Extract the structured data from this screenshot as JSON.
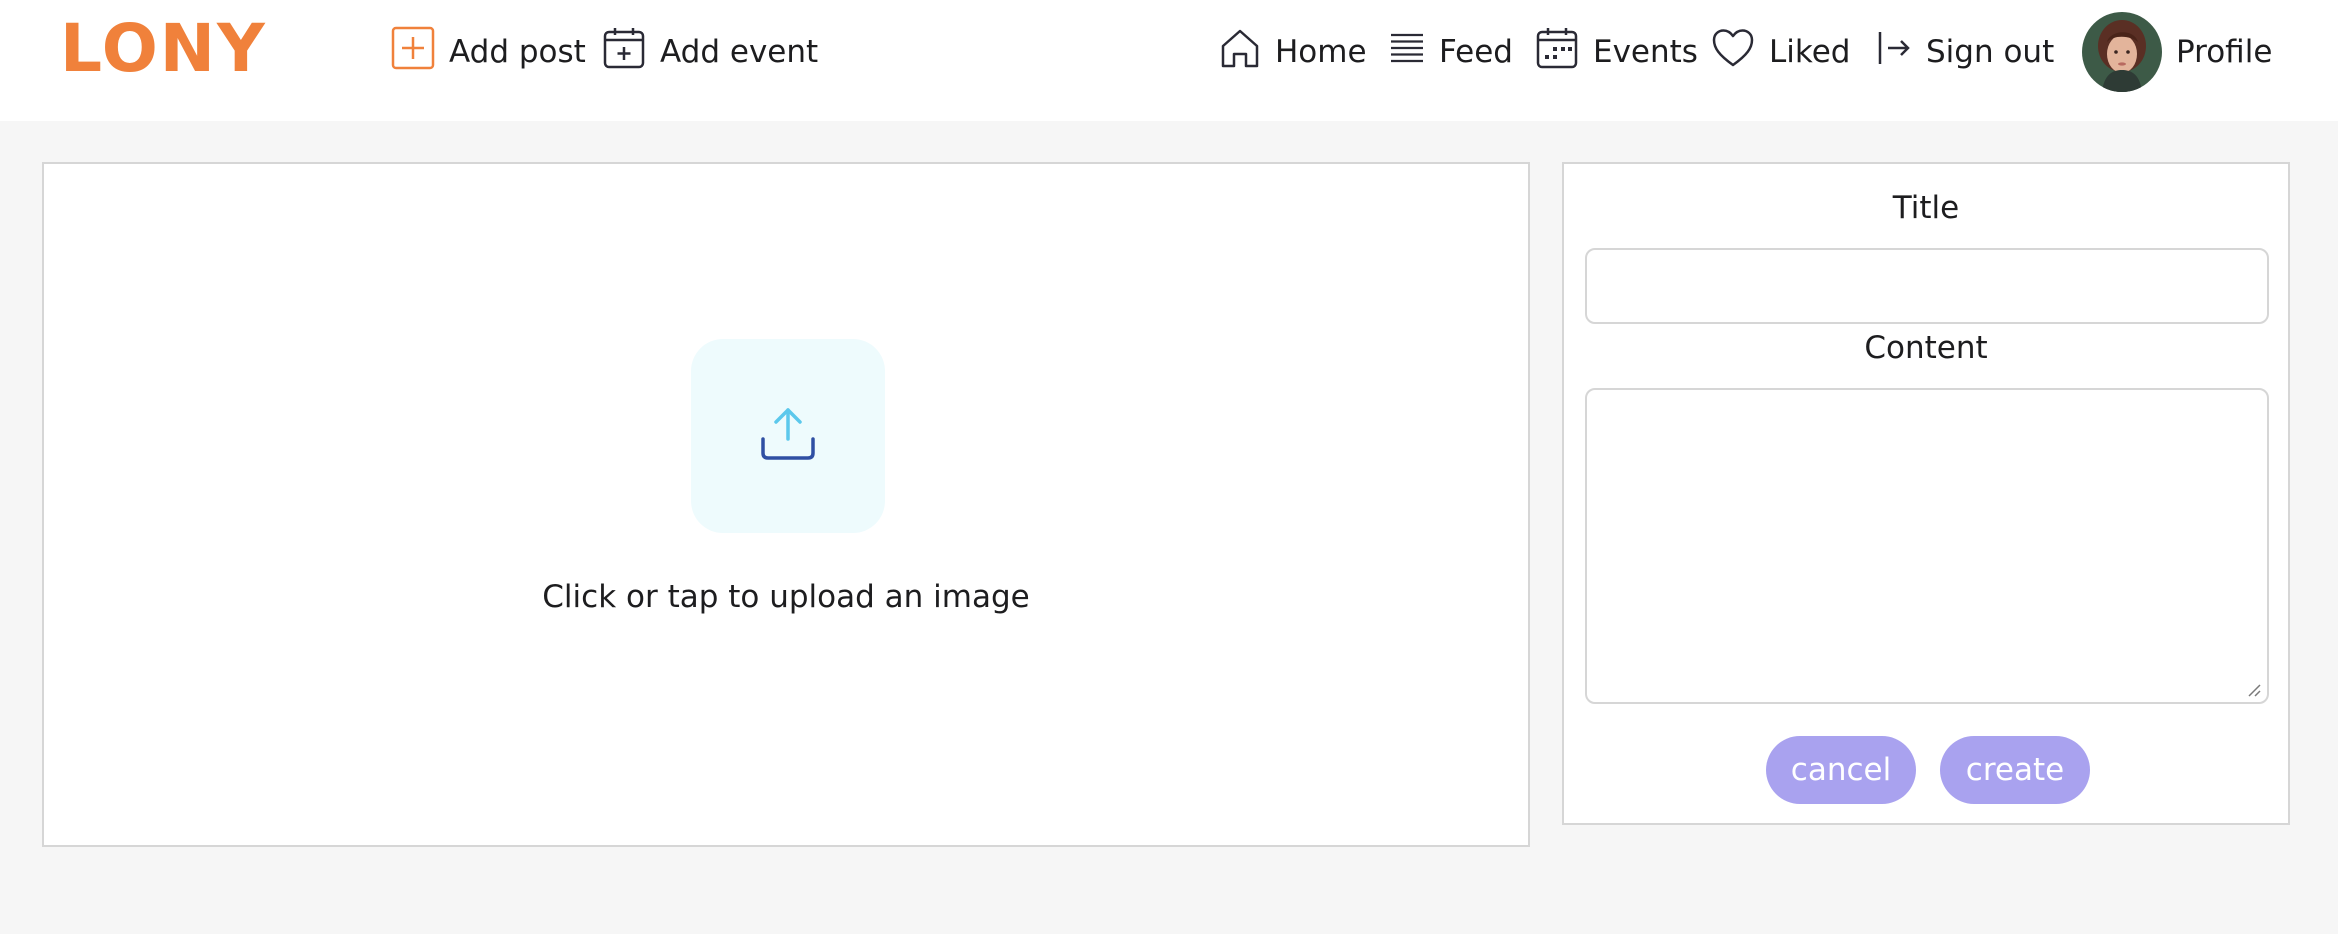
{
  "brand": {
    "logo_text": "LONY",
    "accent": "#f0813b"
  },
  "nav": {
    "add_post": {
      "label": "Add post",
      "icon": "plus-square-icon"
    },
    "add_event": {
      "label": "Add event",
      "icon": "calendar-plus-icon"
    },
    "home": {
      "label": "Home",
      "icon": "home-icon"
    },
    "feed": {
      "label": "Feed",
      "icon": "list-icon"
    },
    "events": {
      "label": "Events",
      "icon": "calendar-icon"
    },
    "liked": {
      "label": "Liked",
      "icon": "heart-icon"
    },
    "sign_out": {
      "label": "Sign out",
      "icon": "sign-out-icon"
    },
    "profile": {
      "label": "Profile",
      "icon": "avatar"
    }
  },
  "upload": {
    "prompt": "Click or tap to upload an image",
    "icon": "upload-icon"
  },
  "form": {
    "title_label": "Title",
    "title_value": "",
    "content_label": "Content",
    "content_value": "",
    "cancel_label": "cancel",
    "create_label": "create",
    "button_color": "#a9a2ef"
  }
}
